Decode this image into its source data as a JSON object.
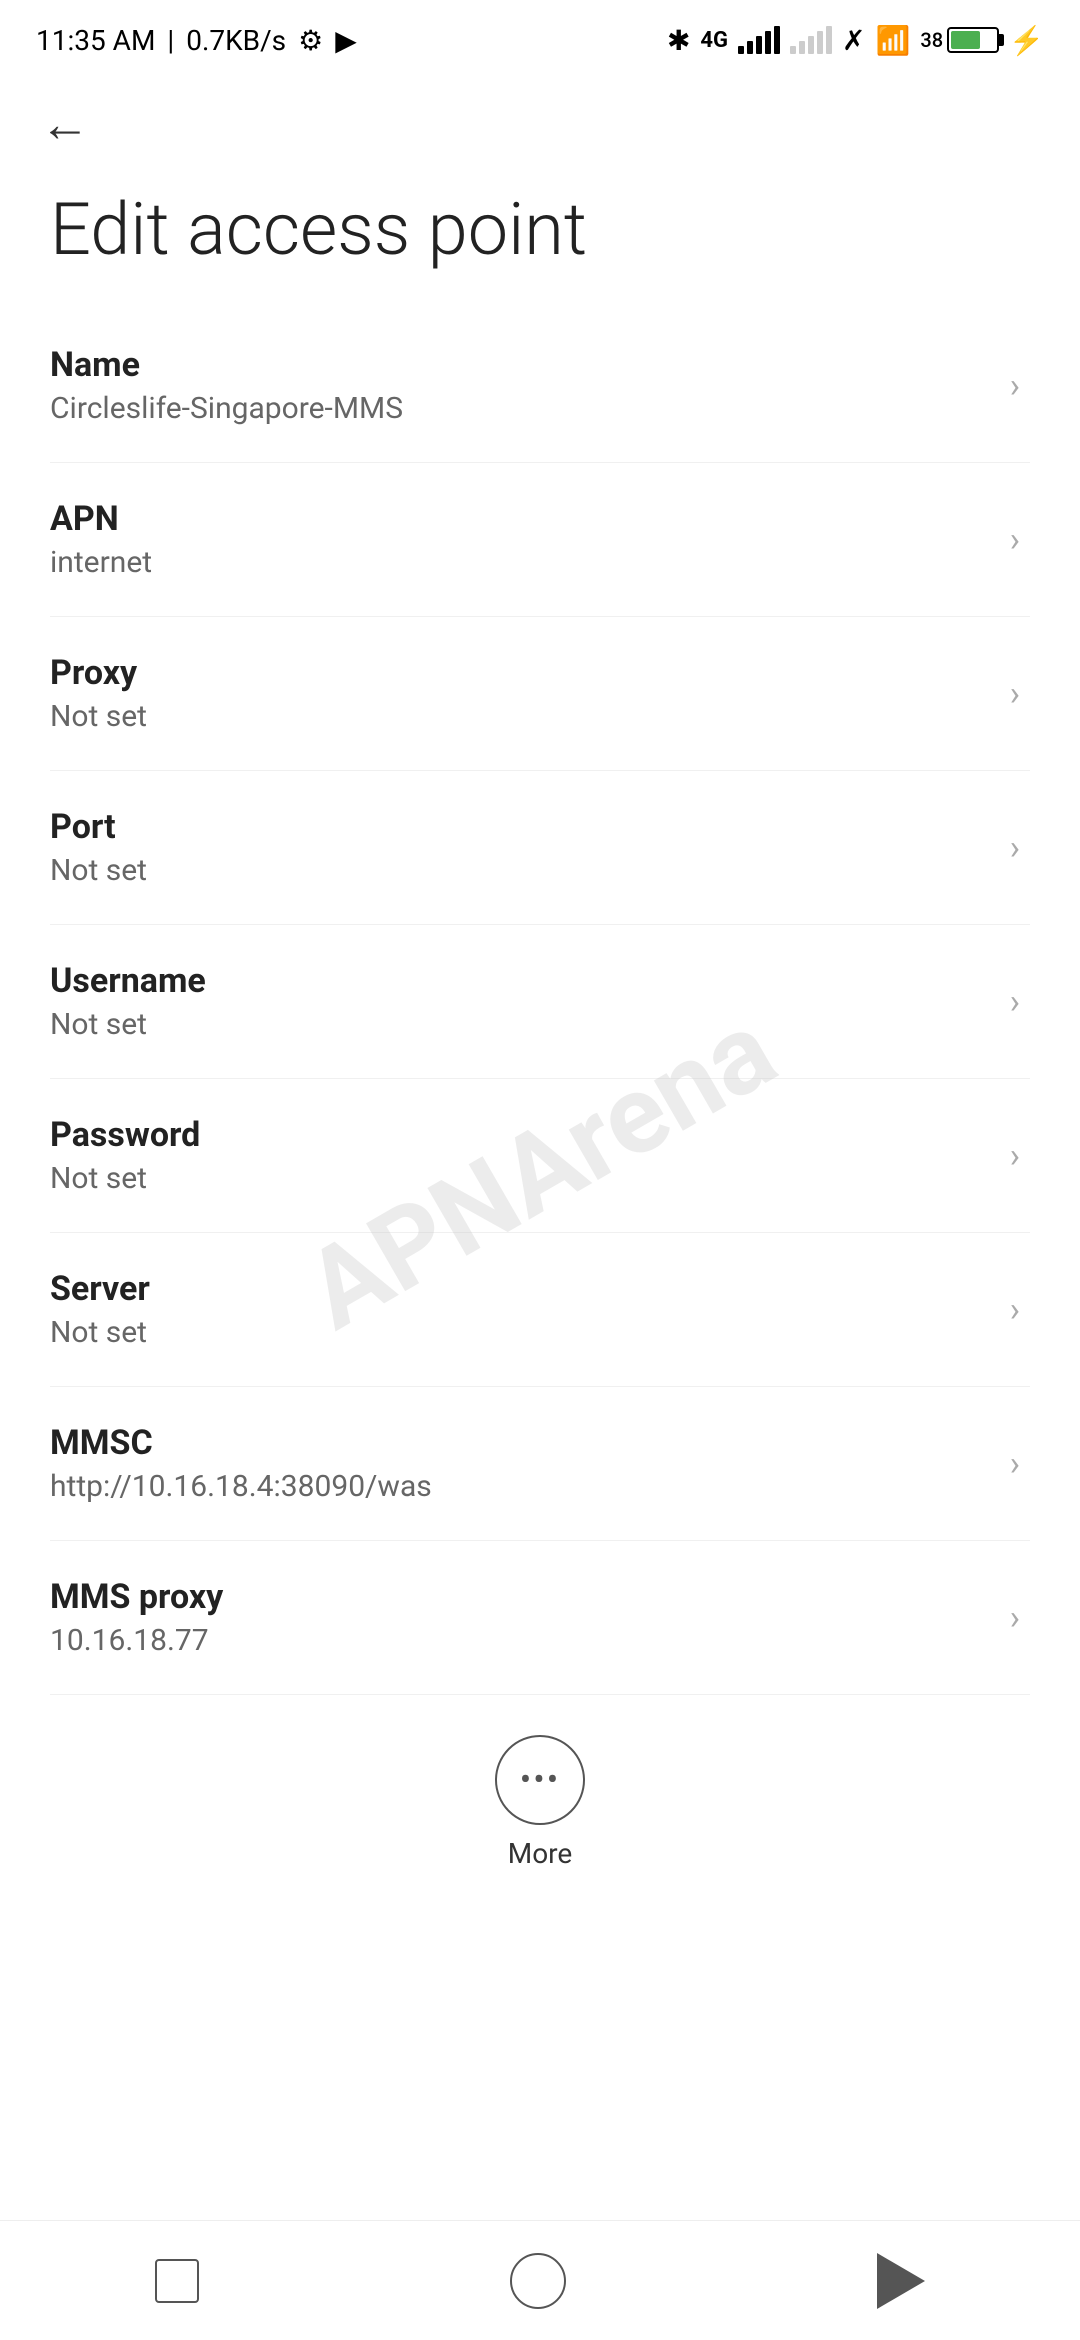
{
  "statusBar": {
    "time": "11:35 AM",
    "speed": "0.7KB/s",
    "batteryPercent": "38"
  },
  "header": {
    "backLabel": "←"
  },
  "page": {
    "title": "Edit access point"
  },
  "settings": [
    {
      "id": "name",
      "label": "Name",
      "value": "Circleslife-Singapore-MMS"
    },
    {
      "id": "apn",
      "label": "APN",
      "value": "internet"
    },
    {
      "id": "proxy",
      "label": "Proxy",
      "value": "Not set"
    },
    {
      "id": "port",
      "label": "Port",
      "value": "Not set"
    },
    {
      "id": "username",
      "label": "Username",
      "value": "Not set"
    },
    {
      "id": "password",
      "label": "Password",
      "value": "Not set"
    },
    {
      "id": "server",
      "label": "Server",
      "value": "Not set"
    },
    {
      "id": "mmsc",
      "label": "MMSC",
      "value": "http://10.16.18.4:38090/was"
    },
    {
      "id": "mms-proxy",
      "label": "MMS proxy",
      "value": "10.16.18.77"
    }
  ],
  "more": {
    "label": "More"
  },
  "watermark": "APNArena"
}
